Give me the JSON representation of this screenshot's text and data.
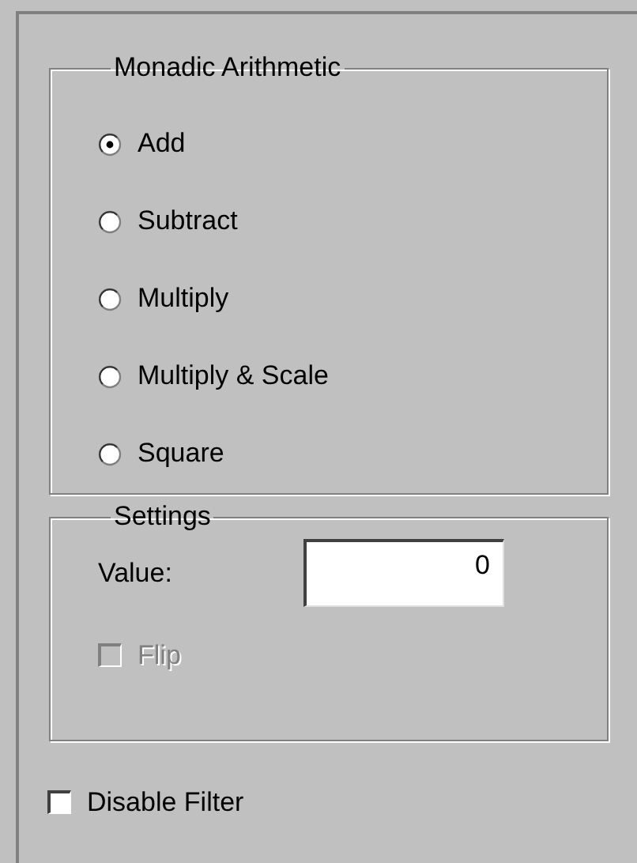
{
  "arithmetic": {
    "title": "Monadic Arithmetic",
    "options": [
      {
        "label": "Add",
        "selected": true
      },
      {
        "label": "Subtract",
        "selected": false
      },
      {
        "label": "Multiply",
        "selected": false
      },
      {
        "label": "Multiply & Scale",
        "selected": false
      },
      {
        "label": "Square",
        "selected": false
      }
    ]
  },
  "settings": {
    "title": "Settings",
    "value_label": "Value:",
    "value": "0",
    "flip": {
      "label": "Flip",
      "checked": false,
      "disabled": true
    }
  },
  "disable_filter": {
    "label": "Disable Filter",
    "checked": false,
    "disabled": false
  }
}
